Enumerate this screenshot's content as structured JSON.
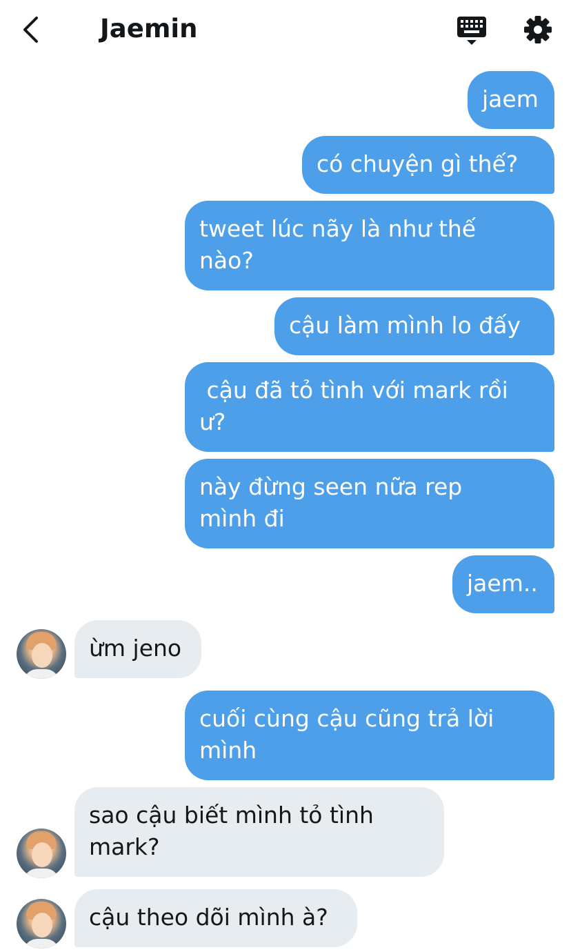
{
  "header": {
    "title": "Jaemin",
    "back_icon": "chevron-left-icon",
    "keyboard_icon": "keyboard-icon",
    "settings_icon": "gear-icon"
  },
  "colors": {
    "sent_bubble": "#4d9fea",
    "received_bubble": "#e6ecf0",
    "text_dark": "#14171a"
  },
  "messages": [
    {
      "from": "me",
      "text": "jaem"
    },
    {
      "from": "me",
      "text": "có chuyện gì thế?"
    },
    {
      "from": "me",
      "text": "tweet lúc nãy là như thế\nnào?"
    },
    {
      "from": "me",
      "text": "cậu làm mình lo đấy"
    },
    {
      "from": "me",
      "text": " cậu đã tỏ tình với mark rồi\nư?"
    },
    {
      "from": "me",
      "text": "này đừng seen nữa rep\nmình đi"
    },
    {
      "from": "me",
      "text": "jaem.."
    },
    {
      "from": "them",
      "text": "ừm jeno"
    },
    {
      "from": "me",
      "text": "cuối cùng cậu cũng trả lời\nmình"
    },
    {
      "from": "them",
      "text": "sao cậu biết mình tỏ tình\nmark?"
    },
    {
      "from": "them",
      "text": "cậu theo dõi mình à?"
    }
  ]
}
